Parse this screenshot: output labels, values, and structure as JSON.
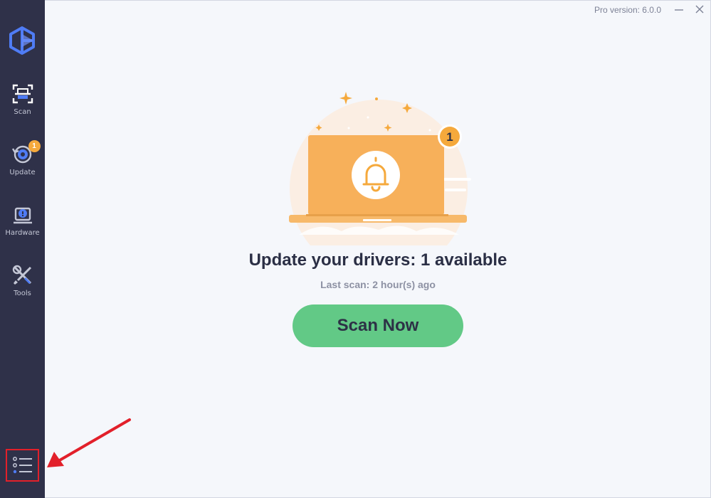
{
  "window": {
    "version_text": "Pro version: 6.0.0",
    "minimize_icon": "minimize-icon",
    "close_icon": "close-icon"
  },
  "sidebar": {
    "logo_icon": "app-logo",
    "items": [
      {
        "label": "Scan",
        "icon": "scan-icon"
      },
      {
        "label": "Update",
        "icon": "update-icon",
        "badge": "1"
      },
      {
        "label": "Hardware",
        "icon": "hardware-icon"
      },
      {
        "label": "Tools",
        "icon": "tools-icon"
      }
    ],
    "menu_icon": "menu-list-icon"
  },
  "main": {
    "illustration_badge": "1",
    "headline": "Update your drivers: 1 available",
    "last_scan": "Last scan: 2 hour(s) ago",
    "scan_button": "Scan Now"
  },
  "colors": {
    "sidebar_bg": "#2f3149",
    "accent_blue": "#4f7cf5",
    "accent_orange": "#f5a93c",
    "button_green": "#62c986",
    "highlight_red": "#e2202a"
  }
}
